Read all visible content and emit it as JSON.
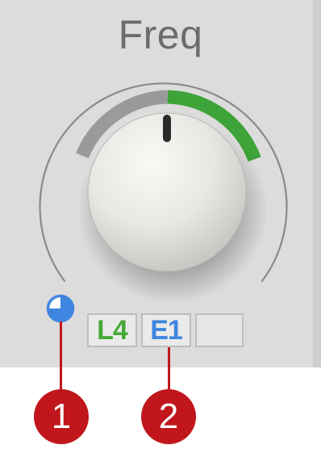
{
  "knob": {
    "title": "Freq",
    "value_fraction": 0.53,
    "colors": {
      "track": "#9a9a9a",
      "active": "#3ea338",
      "indicator": "#2a2a2a"
    }
  },
  "modulation": {
    "slots": [
      {
        "label": "L4",
        "color": "#46a838"
      },
      {
        "label": "E1",
        "color": "#3f86e0"
      },
      {
        "label": ""
      }
    ],
    "icon": "pie-chart-icon"
  },
  "callouts": [
    {
      "number": "1"
    },
    {
      "number": "2"
    }
  ],
  "colors": {
    "callout": "#c0161c",
    "panel": "#dcdcdc"
  }
}
